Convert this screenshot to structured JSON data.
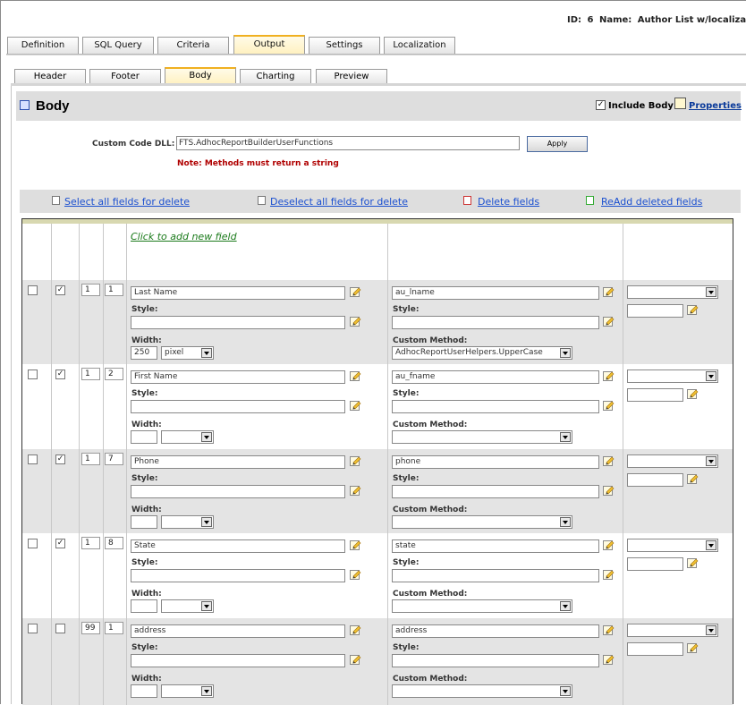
{
  "header": {
    "id_label": "ID:",
    "id_value": "6",
    "name_label": "Name:",
    "name_value": "Author List w/localization"
  },
  "tabs": [
    {
      "label": "Definition",
      "active": false
    },
    {
      "label": "SQL Query",
      "active": false
    },
    {
      "label": "Criteria",
      "active": false
    },
    {
      "label": "Output",
      "active": true
    },
    {
      "label": "Settings",
      "active": false
    },
    {
      "label": "Localization",
      "active": false
    }
  ],
  "sub_tabs": [
    {
      "label": "Header",
      "active": false
    },
    {
      "label": "Footer",
      "active": false
    },
    {
      "label": "Body",
      "active": true
    },
    {
      "label": "Charting",
      "active": false
    },
    {
      "label": "Preview",
      "active": false
    }
  ],
  "body_section": {
    "title": "Body",
    "include_label": "Include Body",
    "include_checked": true,
    "properties_label": "Properties"
  },
  "custom_dll": {
    "label": "Custom Code DLL:",
    "value": "FTS.AdhocReportBuilderUserFunctions",
    "apply_label": "Apply",
    "note": "Note: Methods must return a string"
  },
  "actions": {
    "select_all": "Select all fields for delete",
    "deselect_all": "Deselect all fields for delete",
    "delete_fields": "Delete fields",
    "readd_deleted": "ReAdd deleted fields"
  },
  "grid": {
    "add_field_label": "Click to add new field",
    "style_label": "Style:",
    "width_label": "Width:",
    "custom_method_label": "Custom Method:",
    "rows": [
      {
        "delete": false,
        "visible": true,
        "group": "1",
        "order": "1",
        "caption": "Last Name",
        "style": "",
        "width": "250",
        "width_unit": "pixel",
        "column": "au_lname",
        "col_style": "",
        "custom_method": "AdhocReportUserHelpers.UpperCase",
        "aggregate": "",
        "extra": ""
      },
      {
        "delete": false,
        "visible": true,
        "group": "1",
        "order": "2",
        "caption": "First Name",
        "style": "",
        "width": "",
        "width_unit": "",
        "column": "au_fname",
        "col_style": "",
        "custom_method": "",
        "aggregate": "",
        "extra": ""
      },
      {
        "delete": false,
        "visible": true,
        "group": "1",
        "order": "7",
        "caption": "Phone",
        "style": "",
        "width": "",
        "width_unit": "",
        "column": "phone",
        "col_style": "",
        "custom_method": "",
        "aggregate": "",
        "extra": ""
      },
      {
        "delete": false,
        "visible": true,
        "group": "1",
        "order": "8",
        "caption": "State",
        "style": "",
        "width": "",
        "width_unit": "",
        "column": "state",
        "col_style": "",
        "custom_method": "",
        "aggregate": "",
        "extra": ""
      },
      {
        "delete": false,
        "visible": false,
        "group": "99",
        "order": "1",
        "caption": "address",
        "style": "",
        "width": "",
        "width_unit": "",
        "column": "address",
        "col_style": "",
        "custom_method": "",
        "aggregate": "",
        "extra": ""
      }
    ]
  }
}
